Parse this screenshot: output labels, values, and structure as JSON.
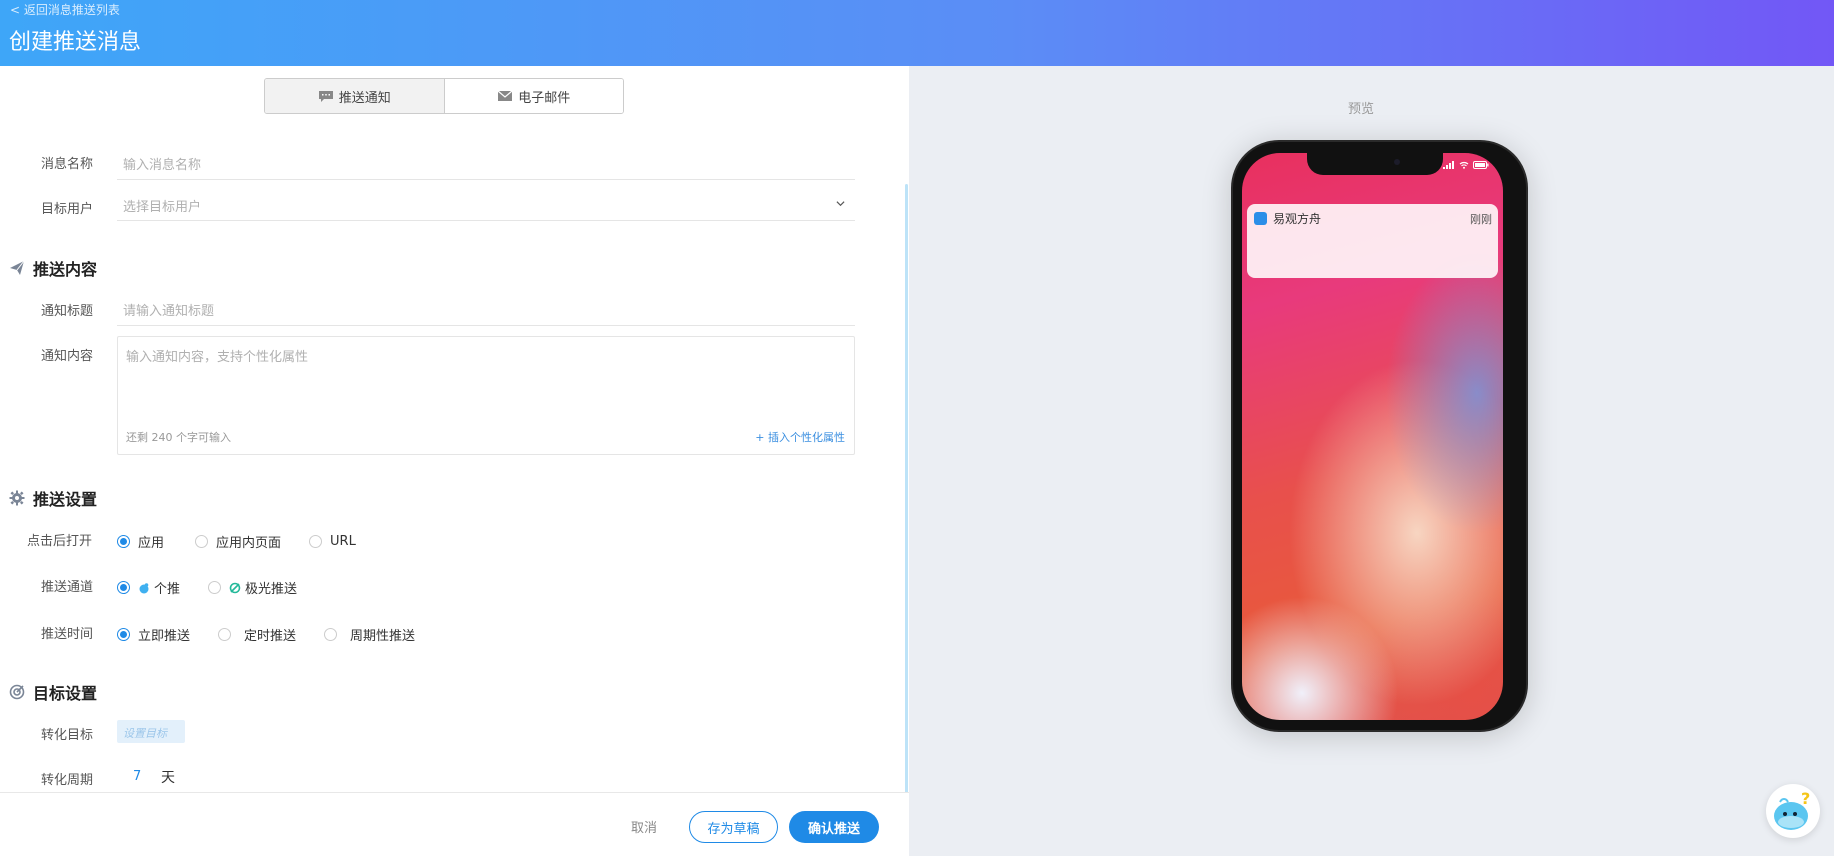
{
  "header": {
    "back_link": "< 返回消息推送列表",
    "title": "创建推送消息"
  },
  "tabs": [
    {
      "label": "推送通知",
      "icon": "chat-icon",
      "active": true
    },
    {
      "label": "电子邮件",
      "icon": "mail-icon",
      "active": false
    }
  ],
  "form": {
    "message_name": {
      "label": "消息名称",
      "placeholder": "输入消息名称"
    },
    "target_users": {
      "label": "目标用户",
      "placeholder": "选择目标用户"
    }
  },
  "push_content": {
    "title": "推送内容",
    "icon": "send-icon",
    "notif_title": {
      "label": "通知标题",
      "placeholder": "请输入通知标题"
    },
    "notif_body": {
      "label": "通知内容",
      "placeholder": "输入通知内容，支持个性化属性",
      "remaining": "还剩 240 个字可输入",
      "insert_attr": "+ 插入个性化属性"
    }
  },
  "push_settings": {
    "title": "推送设置",
    "icon": "gear-icon",
    "open_after_click": {
      "label": "点击后打开",
      "options": [
        "应用",
        "应用内页面",
        "URL"
      ],
      "selected": "应用"
    },
    "channel": {
      "label": "推送通道",
      "options": [
        "个推",
        "极光推送"
      ],
      "selected": "个推"
    },
    "time": {
      "label": "推送时间",
      "options": [
        "立即推送",
        "定时推送",
        "周期性推送"
      ],
      "selected": "立即推送"
    }
  },
  "target_settings": {
    "title": "目标设置",
    "icon": "target-icon",
    "conversion_goal": {
      "label": "转化目标",
      "button": "设置目标"
    },
    "conversion_period": {
      "label": "转化周期",
      "value": "7",
      "unit": "天"
    }
  },
  "footer": {
    "cancel": "取消",
    "save_draft": "存为草稿",
    "confirm": "确认推送"
  },
  "preview": {
    "label": "预览",
    "app_name": "易观方舟",
    "time": "刚刚"
  },
  "colors": {
    "accent": "#1f8ae6",
    "header_start": "#3ea6f8",
    "header_end": "#7257f6"
  }
}
